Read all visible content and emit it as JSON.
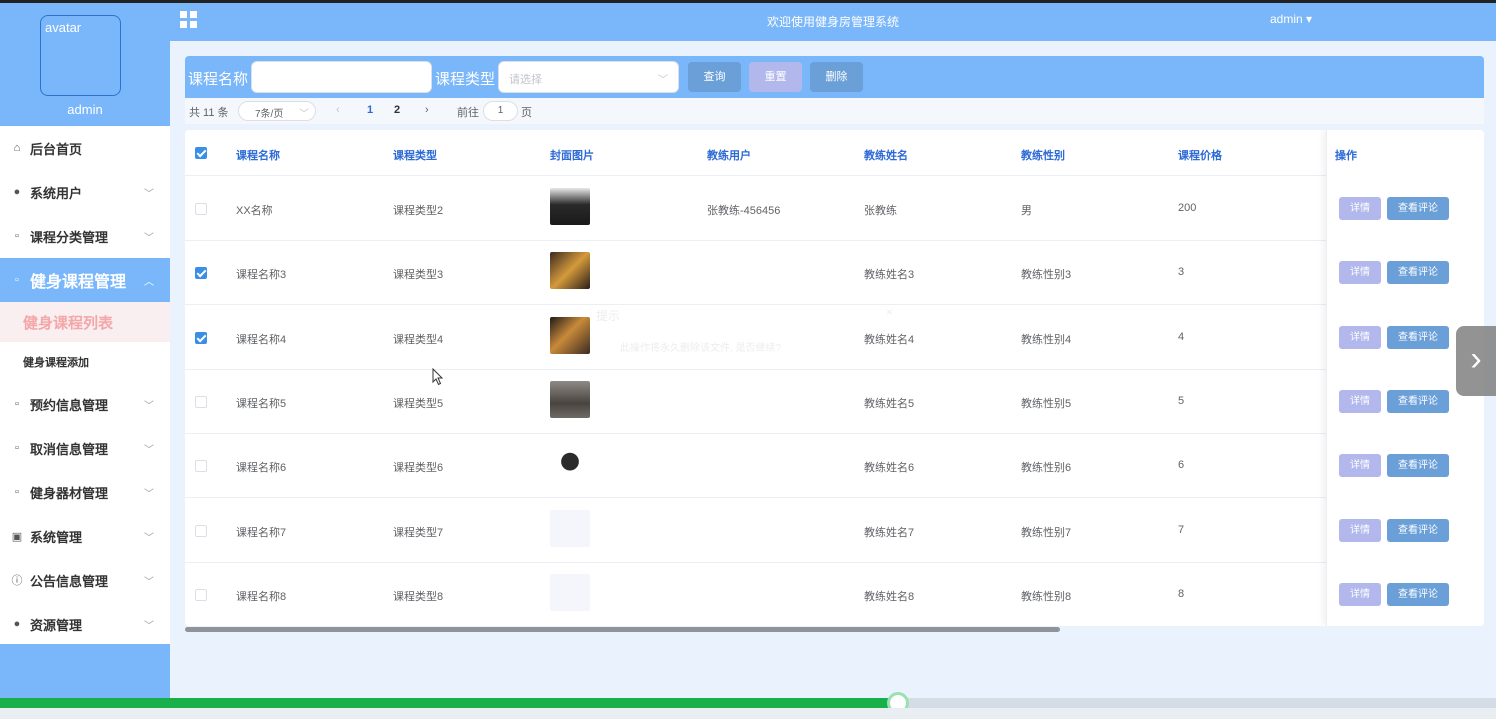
{
  "header": {
    "title": "欢迎使用健身房管理系统",
    "user": "admin ▾"
  },
  "sidebar": {
    "avatar_alt": "avatar",
    "username": "admin",
    "items": [
      {
        "label": "后台首页",
        "icon": "home-icon",
        "glyph": "⌂"
      },
      {
        "label": "系统用户",
        "icon": "user-icon",
        "glyph": "●"
      },
      {
        "label": "课程分类管理",
        "icon": "doc-icon",
        "glyph": "▫"
      },
      {
        "label": "健身课程管理",
        "icon": "doc-icon",
        "glyph": "▫"
      },
      {
        "label": "预约信息管理",
        "icon": "doc-icon",
        "glyph": "▫"
      },
      {
        "label": "取消信息管理",
        "icon": "doc-icon",
        "glyph": "▫"
      },
      {
        "label": "健身器材管理",
        "icon": "doc-icon",
        "glyph": "▫"
      },
      {
        "label": "系统管理",
        "icon": "chart-icon",
        "glyph": "▣"
      },
      {
        "label": "公告信息管理",
        "icon": "info-icon",
        "glyph": "ⓘ"
      },
      {
        "label": "资源管理",
        "icon": "location-icon",
        "glyph": "●"
      }
    ],
    "sub_items": [
      "健身课程列表",
      "健身课程添加"
    ]
  },
  "search": {
    "name_label": "课程名称",
    "name_value": "",
    "type_label": "课程类型",
    "type_placeholder": "请选择",
    "query_button": "查询",
    "reset_button": "重置",
    "delete_button": "删除"
  },
  "pager": {
    "total": "共 11 条",
    "page_size": "7条/页",
    "prev": "‹",
    "pages": [
      "1",
      "2"
    ],
    "next": "›",
    "goto_label": "前往",
    "goto_value": "1",
    "page_suffix": "页"
  },
  "table": {
    "columns": [
      "课程名称",
      "课程类型",
      "封面图片",
      "教练用户",
      "教练姓名",
      "教练性别",
      "课程价格",
      "操作"
    ],
    "rows": [
      {
        "checked": false,
        "name": "XX名称",
        "type": "课程类型2",
        "coach_user": "张教练-456456",
        "coach_name": "张教练",
        "coach_gender": "男",
        "price": "200"
      },
      {
        "checked": true,
        "name": "课程名称3",
        "type": "课程类型3",
        "coach_user": "",
        "coach_name": "教练姓名3",
        "coach_gender": "教练性别3",
        "price": "3"
      },
      {
        "checked": true,
        "name": "课程名称4",
        "type": "课程类型4",
        "coach_user": "",
        "coach_name": "教练姓名4",
        "coach_gender": "教练性别4",
        "price": "4"
      },
      {
        "checked": false,
        "name": "课程名称5",
        "type": "课程类型5",
        "coach_user": "",
        "coach_name": "教练姓名5",
        "coach_gender": "教练性别5",
        "price": "5"
      },
      {
        "checked": false,
        "name": "课程名称6",
        "type": "课程类型6",
        "coach_user": "",
        "coach_name": "教练姓名6",
        "coach_gender": "教练性别6",
        "price": "6"
      },
      {
        "checked": false,
        "name": "课程名称7",
        "type": "课程类型7",
        "coach_user": "",
        "coach_name": "教练姓名7",
        "coach_gender": "教练性别7",
        "price": "7"
      },
      {
        "checked": false,
        "name": "课程名称8",
        "type": "课程类型8",
        "coach_user": "",
        "coach_name": "教练姓名8",
        "coach_gender": "教练性别8",
        "price": "8"
      }
    ],
    "detail_button": "详情",
    "comment_button": "查看评论"
  },
  "ghost_dialog": {
    "title": "提示",
    "close": "×",
    "message": "此操作将永久删除该文件, 是否继续?"
  },
  "video": {
    "progress": 0.6
  },
  "colors": {
    "primary": "#79b6fa",
    "accent": "#2d6ad6",
    "progress": "#18b04b"
  }
}
